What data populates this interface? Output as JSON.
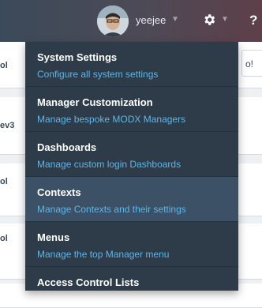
{
  "header": {
    "username": "yeejee",
    "caret": "▼",
    "help_glyph": "?"
  },
  "background": {
    "rows": [
      {
        "text": "ol"
      },
      {
        "text": "ev3"
      },
      {
        "text": "ol"
      },
      {
        "text": "ol"
      },
      {
        "text": ""
      }
    ],
    "right_tab": "o!"
  },
  "menu": {
    "items": [
      {
        "title": "System Settings",
        "description": "Configure all system settings",
        "active": false
      },
      {
        "title": "Manager Customization",
        "description": "Manage bespoke MODX Managers",
        "active": false
      },
      {
        "title": "Dashboards",
        "description": "Manage custom login Dashboards",
        "active": false
      },
      {
        "title": "Contexts",
        "description": "Manage Contexts and their settings",
        "active": true
      },
      {
        "title": "Menus",
        "description": "Manage the top Manager menu",
        "active": false
      },
      {
        "title": "Access Control Lists",
        "description": "",
        "active": false
      }
    ]
  },
  "colors": {
    "menu_bg": "#2e3c4a",
    "menu_active_bg": "#3d5166",
    "menu_desc": "#5bb6e8"
  }
}
